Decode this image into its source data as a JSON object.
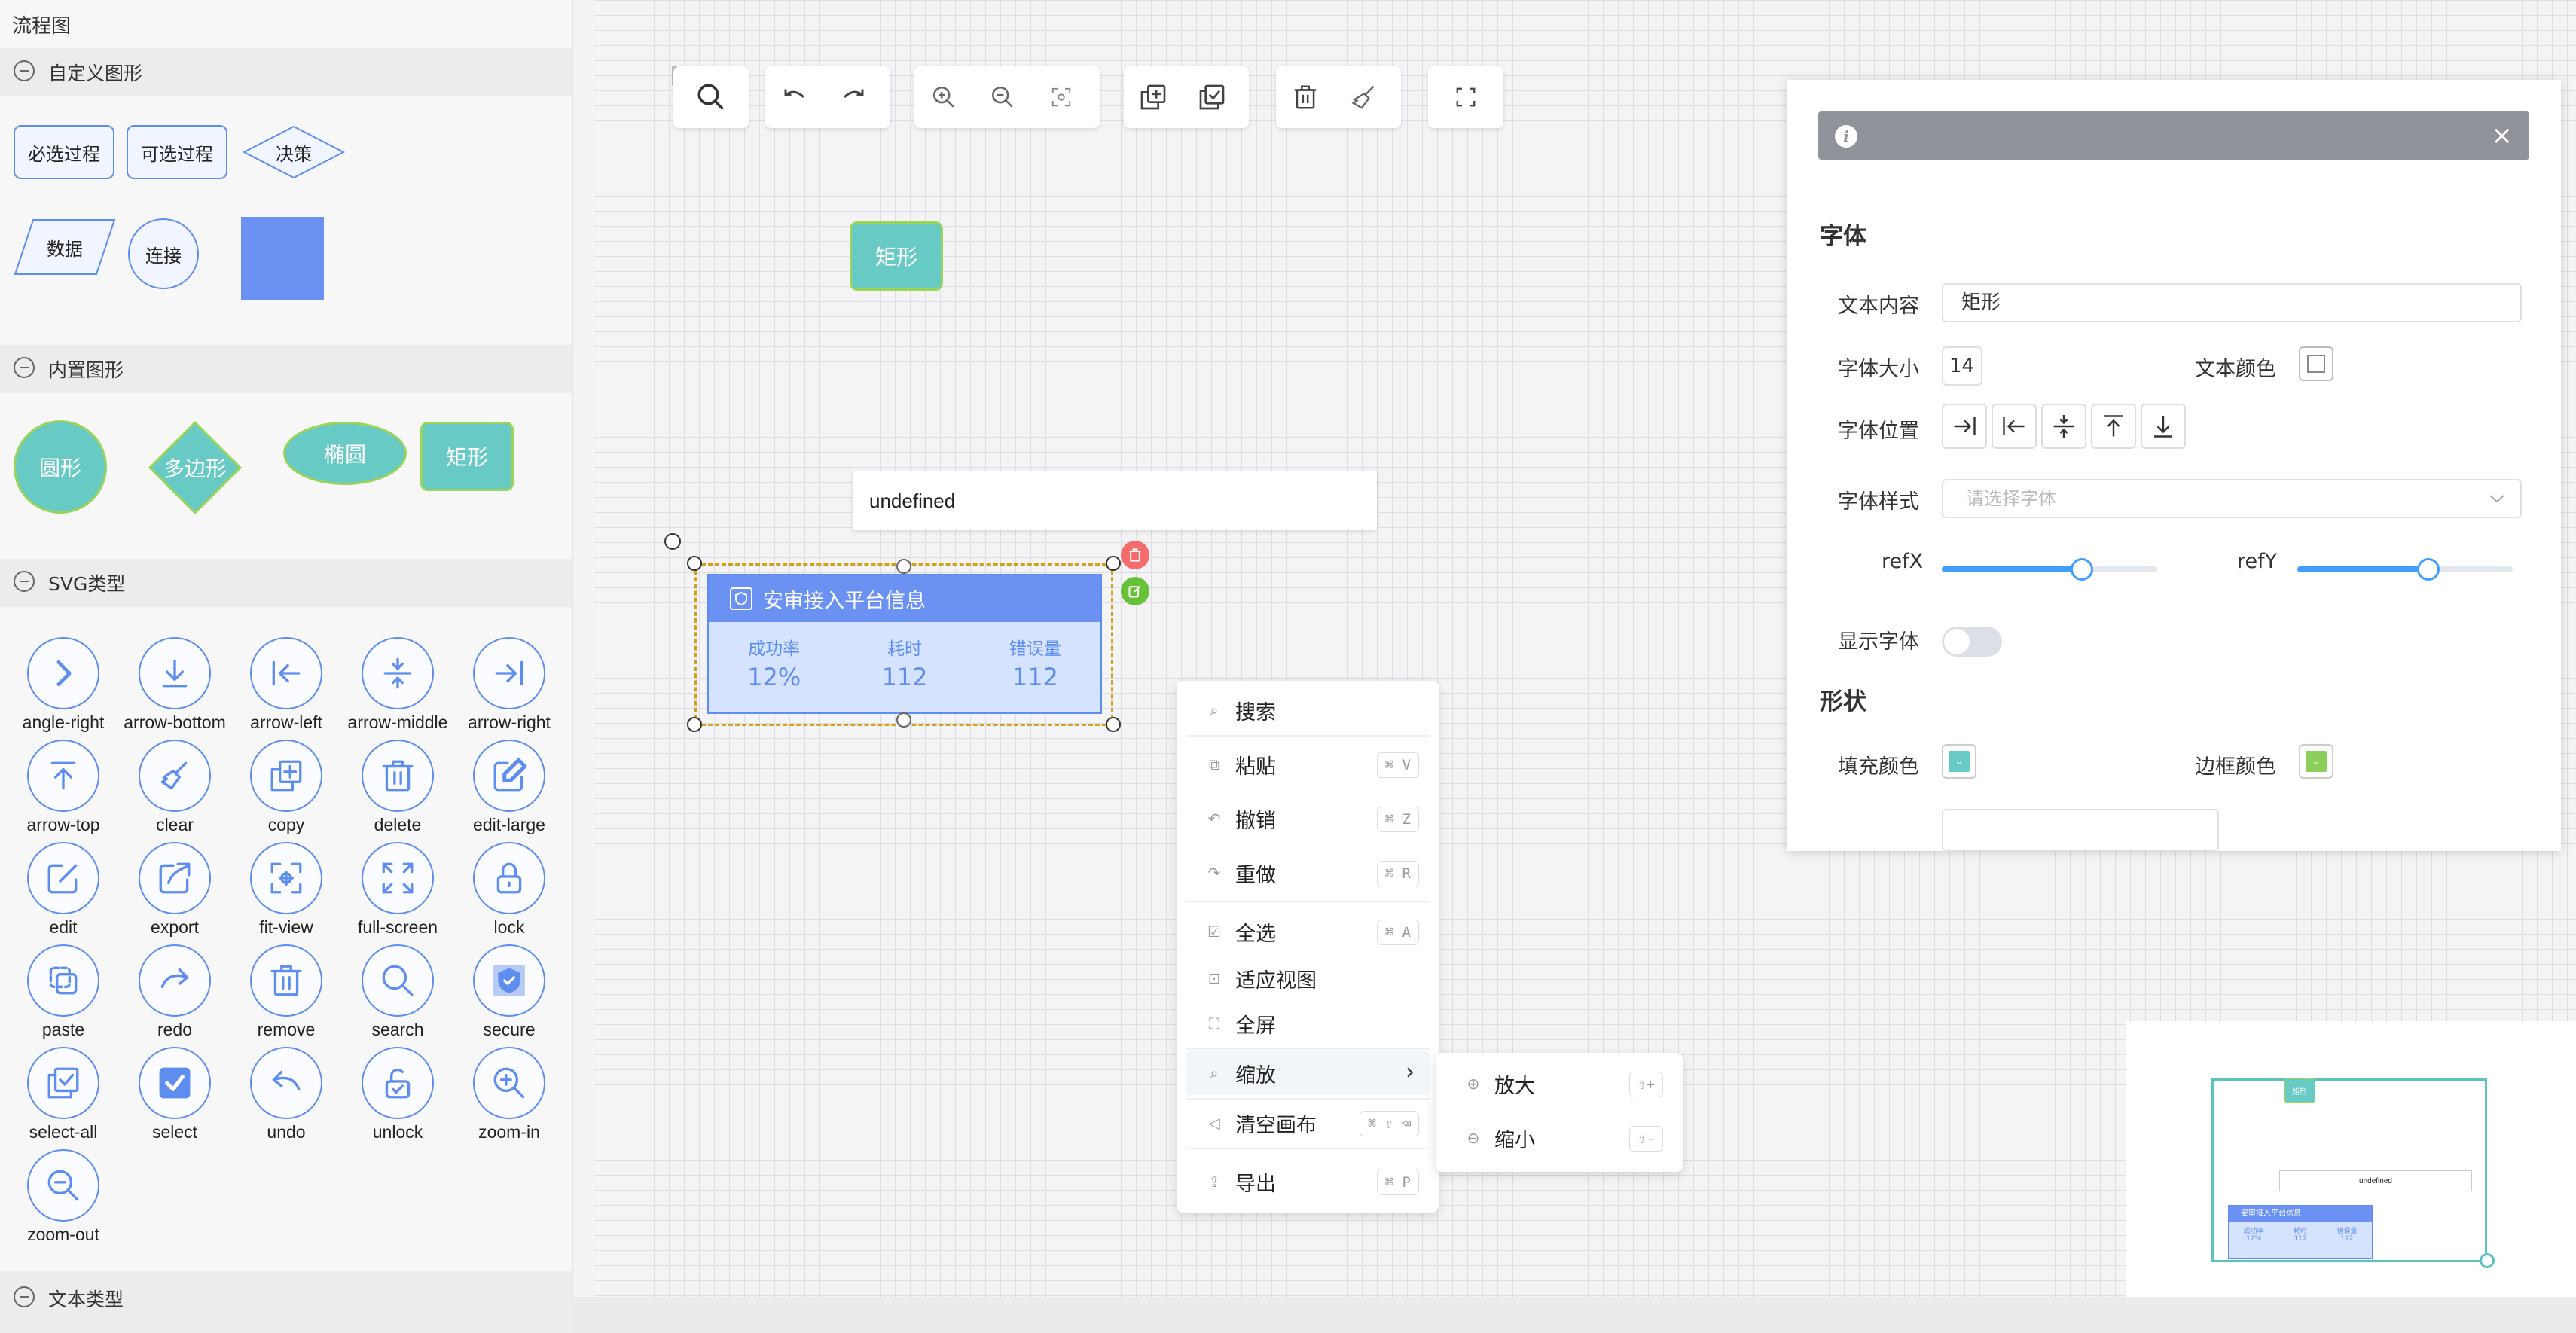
{
  "sidebar": {
    "title": "流程图",
    "sections": {
      "custom": "自定义图形",
      "builtin": "内置图形",
      "svg": "SVG类型",
      "text": "文本类型"
    },
    "custom_shapes": [
      "必选过程",
      "可选过程",
      "决策",
      "数据",
      "连接"
    ],
    "builtin_shapes": [
      "圆形",
      "多边形",
      "椭圆",
      "矩形"
    ],
    "svg_items": [
      "angle-right",
      "arrow-bottom",
      "arrow-left",
      "arrow-middle",
      "arrow-right",
      "arrow-top",
      "clear",
      "copy",
      "delete",
      "edit-large",
      "edit",
      "export",
      "fit-view",
      "full-screen",
      "lock",
      "paste",
      "redo",
      "remove",
      "search",
      "secure",
      "select-all",
      "select",
      "undo",
      "unlock",
      "zoom-in",
      "zoom-out"
    ]
  },
  "canvas": {
    "rect_node": "矩形",
    "text_node": "undefined",
    "card": {
      "title": "安审接入平台信息",
      "stats": [
        {
          "label": "成功率",
          "value": "12%"
        },
        {
          "label": "耗时",
          "value": "112"
        },
        {
          "label": "错误量",
          "value": "112"
        }
      ]
    }
  },
  "context_menu": {
    "items": [
      {
        "label": "搜索",
        "shortcut": ""
      },
      {
        "label": "粘贴",
        "shortcut": "⌘ V"
      },
      {
        "label": "撤销",
        "shortcut": "⌘ Z"
      },
      {
        "label": "重做",
        "shortcut": "⌘ R"
      },
      {
        "label": "全选",
        "shortcut": "⌘ A"
      },
      {
        "label": "适应视图",
        "shortcut": ""
      },
      {
        "label": "全屏",
        "shortcut": ""
      },
      {
        "label": "缩放",
        "shortcut": ""
      },
      {
        "label": "清空画布",
        "shortcut": "⌘ ⇧ ⌫"
      },
      {
        "label": "导出",
        "shortcut": "⌘ P"
      }
    ],
    "submenu": [
      {
        "label": "放大",
        "shortcut": "⇧+"
      },
      {
        "label": "缩小",
        "shortcut": "⇧-"
      }
    ]
  },
  "panel": {
    "close": "×",
    "font_section": "字体",
    "text_content_label": "文本内容",
    "text_content_value": "矩形",
    "font_size_label": "字体大小",
    "font_size_value": "14",
    "text_color_label": "文本颜色",
    "font_position_label": "字体位置",
    "font_style_label": "字体样式",
    "font_style_placeholder": "请选择字体",
    "refx_label": "refX",
    "refx_value": 0.65,
    "refy_label": "refY",
    "refy_value": 0.61,
    "show_font_label": "显示字体",
    "shape_section": "形状",
    "fill_color_label": "填充颜色",
    "fill_color": "#68cac4",
    "border_color_label": "边框颜色",
    "border_color": "#8bcf5a"
  },
  "minimap": {
    "node_label": "矩形",
    "text_node": "undefined",
    "card_title": "安审接入平台信息",
    "stats": [
      {
        "label": "成功率",
        "value": "12%"
      },
      {
        "label": "耗时",
        "value": "112"
      },
      {
        "label": "错误量",
        "value": "112"
      }
    ]
  },
  "colors": {
    "accent_blue": "#5d8dee",
    "teal": "#68cac4",
    "green_border": "#9ad45a",
    "delete_red": "#f56c6c",
    "edit_green": "#67c23a"
  }
}
